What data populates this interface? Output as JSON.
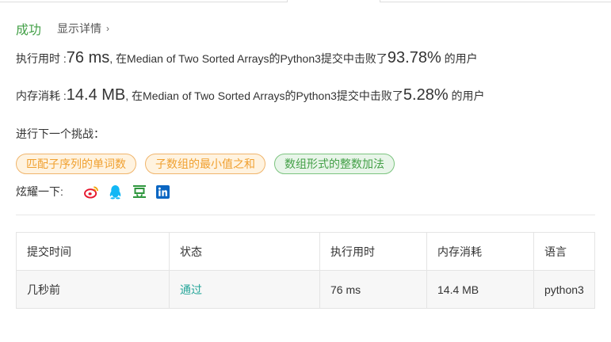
{
  "result": {
    "status": "成功",
    "details_link": "显示详情",
    "details_chevron": "›"
  },
  "runtime": {
    "label": "执行用时 : ",
    "value": "76 ms",
    "mid_text": ", 在Median of Two Sorted Arrays的Python3提交中击败了",
    "percent": "93.78%",
    "suffix": " 的用户"
  },
  "memory": {
    "label": "内存消耗 : ",
    "value": "14.4 MB",
    "mid_text": ", 在Median of Two Sorted Arrays的Python3提交中击败了",
    "percent": "5.28%",
    "suffix": " 的用户"
  },
  "next_challenge": {
    "label": "进行下一个挑战：",
    "chips": [
      {
        "label": "匹配子序列的单词数",
        "level": "medium"
      },
      {
        "label": "子数组的最小值之和",
        "level": "medium"
      },
      {
        "label": "数组形式的整数加法",
        "level": "easy"
      }
    ]
  },
  "share": {
    "label": "炫耀一下:",
    "icons": [
      "weibo-icon",
      "qq-icon",
      "douban-icon",
      "linkedin-icon"
    ]
  },
  "submissions": {
    "headers": [
      "提交时间",
      "状态",
      "执行用时",
      "内存消耗",
      "语言"
    ],
    "rows": [
      {
        "time": "几秒前",
        "status": "通过",
        "runtime": "76 ms",
        "memory": "14.4 MB",
        "language": "python3"
      }
    ]
  },
  "colors": {
    "success": "#43a047",
    "medium_chip_text": "#f0a030",
    "easy_chip_text": "#43a047",
    "pass_status": "#26a69a",
    "weibo": "#e6162d",
    "qq": "#12b7f5",
    "douban": "#2e963d",
    "linkedin": "#0a66c2"
  }
}
